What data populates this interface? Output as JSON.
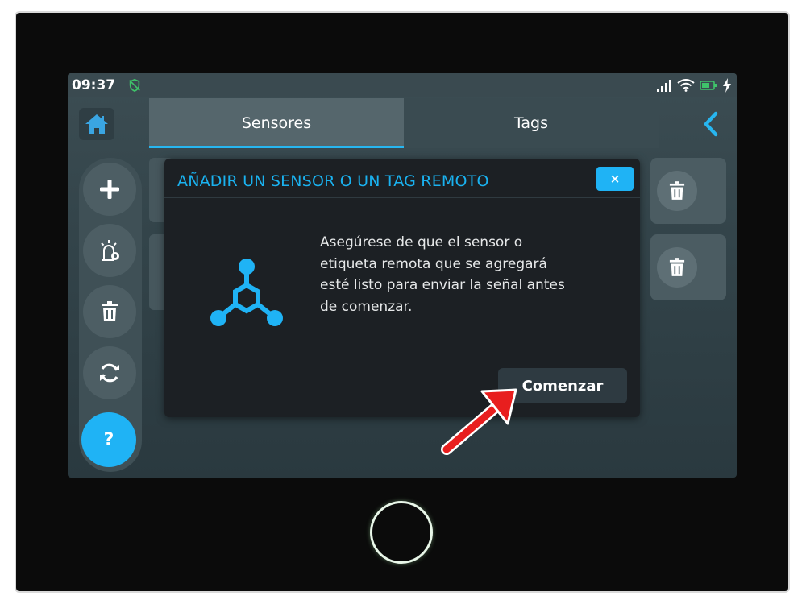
{
  "status_bar": {
    "time": "09:37",
    "icons": [
      "shield-off-icon",
      "signal-icon",
      "wifi-icon",
      "battery-icon",
      "charging-bolt-icon"
    ]
  },
  "nav": {
    "home_icon": "home-icon",
    "tabs": [
      {
        "label": "Sensores",
        "active": true
      },
      {
        "label": "Tags",
        "active": false
      }
    ],
    "back_icon": "chevron-left-icon"
  },
  "sidebar": {
    "buttons": [
      "add-icon",
      "alarm-settings-icon",
      "trash-icon",
      "sync-icon"
    ],
    "help_label": "?"
  },
  "modal": {
    "title": "AÑADIR UN SENSOR O UN TAG REMOTO",
    "close_label": "×",
    "icon": "network-nodes-icon",
    "message_lines": [
      "Asegúrese de que el sensor o",
      "etiqueta remota que se agregará",
      "esté listo para enviar la señal antes",
      "de comenzar."
    ],
    "start_label": "Comenzar"
  },
  "annotation": {
    "arrow": "red-arrow-icon"
  },
  "colors": {
    "accent": "#1fb3f5",
    "modal_bg": "#1c2024",
    "screen_bg": "#33444a",
    "annotation_red": "#e81e1e"
  }
}
